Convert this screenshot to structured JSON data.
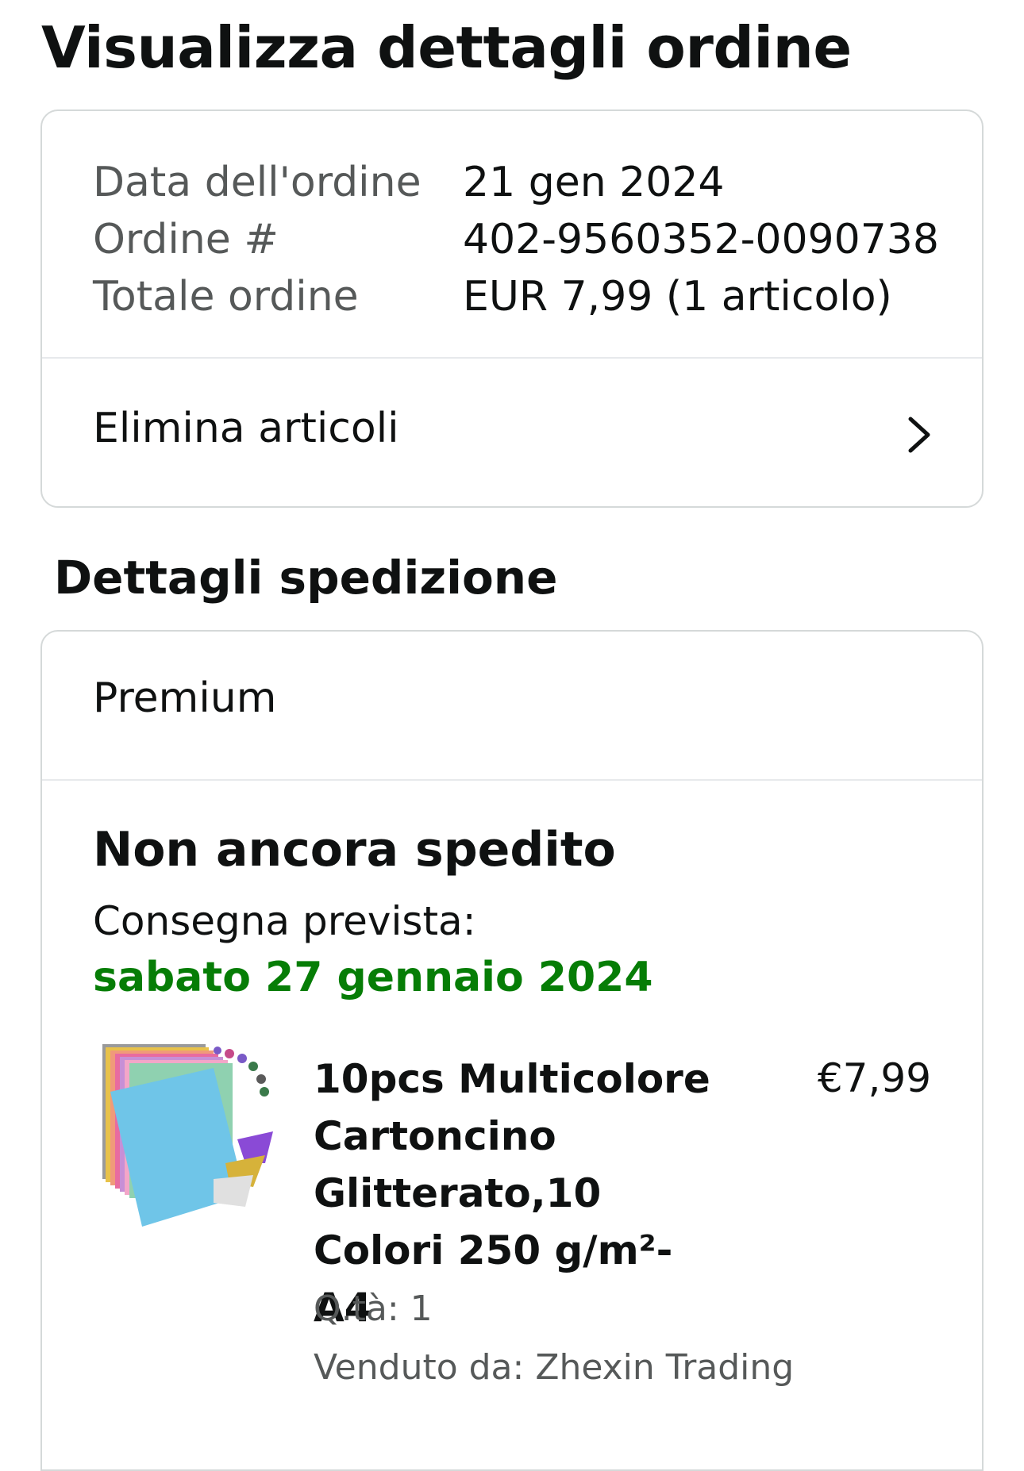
{
  "page": {
    "title": "Visualizza dettagli ordine"
  },
  "order_summary": {
    "rows": [
      {
        "label": "Data dell'ordine",
        "value": "21 gen 2024"
      },
      {
        "label": "Ordine #",
        "value": "402-9560352-0090738"
      },
      {
        "label": "Totale ordine",
        "value": "EUR 7,99 (1 articolo)"
      }
    ],
    "action_label": "Elimina articoli",
    "action_icon": "chevron-right-icon"
  },
  "shipping": {
    "section_title": "Dettagli spedizione",
    "method": "Premium",
    "status": "Non ancora spedito",
    "delivery_label": "Consegna prevista:",
    "delivery_date": "sabato 27 gennaio 2024",
    "colors": {
      "delivery_date": "#067d06"
    },
    "item": {
      "title": "10pcs Multicolore Cartoncino Glitterato,10 Colori 250 g/m²-A4",
      "price": "€7,99",
      "quantity": "Q.tà: 1",
      "seller": "Venduto da: Zhexin Trading",
      "image_icon": "product-thumbnail-glitter-cardstock"
    }
  }
}
